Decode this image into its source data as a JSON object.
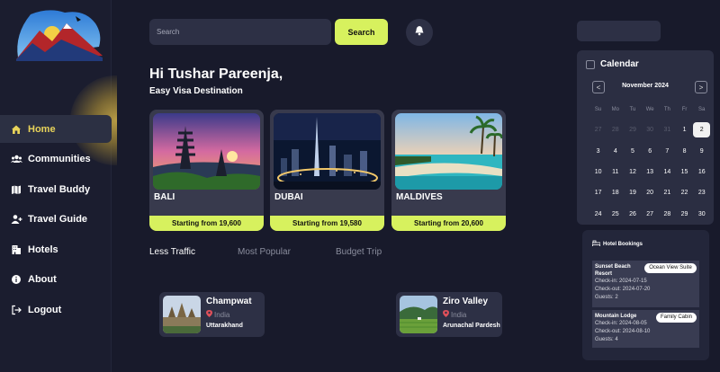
{
  "sidebar": {
    "items": [
      {
        "label": "Home",
        "icon": "home-icon",
        "active": true
      },
      {
        "label": "Communities",
        "icon": "users-icon"
      },
      {
        "label": "Travel Buddy",
        "icon": "map-icon"
      },
      {
        "label": "Travel Guide",
        "icon": "user-plus-icon"
      },
      {
        "label": "Hotels",
        "icon": "building-icon"
      },
      {
        "label": "About",
        "icon": "info-icon"
      },
      {
        "label": "Logout",
        "icon": "logout-icon"
      }
    ]
  },
  "header": {
    "search_placeholder": "Search",
    "search_button": "Search"
  },
  "greeting": {
    "title": "Hi Tushar Pareenja,",
    "subtitle": "Easy Visa Destination"
  },
  "destinations": [
    {
      "name": "BALI",
      "price": "Starting from 19,600"
    },
    {
      "name": "DUBAI",
      "price": "Starting from 19,580"
    },
    {
      "name": "MALDIVES",
      "price": "Starting from 20,600"
    }
  ],
  "tabs": [
    {
      "label": "Less Traffic",
      "active": true
    },
    {
      "label": "Most Popular"
    },
    {
      "label": "Budget Trip"
    }
  ],
  "places": [
    {
      "name": "Champwat",
      "country": "India",
      "state": "Uttarakhand"
    },
    {
      "name": "Ziro Valley",
      "country": "India",
      "state": "Arunachal Pardesh"
    }
  ],
  "calendar": {
    "title": "Calendar",
    "month": "November 2024",
    "prev": "<",
    "next": ">",
    "weekdays": [
      "Su",
      "Mo",
      "Tu",
      "We",
      "Th",
      "Fr",
      "Sa"
    ],
    "weeks": [
      [
        "27",
        "28",
        "29",
        "30",
        "31",
        "1",
        "2"
      ],
      [
        "3",
        "4",
        "5",
        "6",
        "7",
        "8",
        "9"
      ],
      [
        "10",
        "11",
        "12",
        "13",
        "14",
        "15",
        "16"
      ],
      [
        "17",
        "18",
        "19",
        "20",
        "21",
        "22",
        "23"
      ],
      [
        "24",
        "25",
        "26",
        "27",
        "28",
        "29",
        "30"
      ]
    ],
    "selected_day": "2"
  },
  "hotel_bookings": {
    "title": "Hotel Bookings",
    "items": [
      {
        "hotel": "Sunset Beach Resort",
        "room": "Ocean View Suite",
        "check_in": "Check-in: 2024-07-15",
        "check_out": "Check-out: 2024-07-20",
        "guests": "Guests: 2"
      },
      {
        "hotel": "Mountain Lodge",
        "room": "Family Cabin",
        "check_in": "Check-in: 2024-08-05",
        "check_out": "Check-out: 2024-08-10",
        "guests": "Guests: 4"
      }
    ]
  },
  "colors": {
    "accent": "#d7f15e",
    "active_nav_text": "#e8d35a",
    "background": "#181a2b",
    "panel": "#2b2e42"
  }
}
